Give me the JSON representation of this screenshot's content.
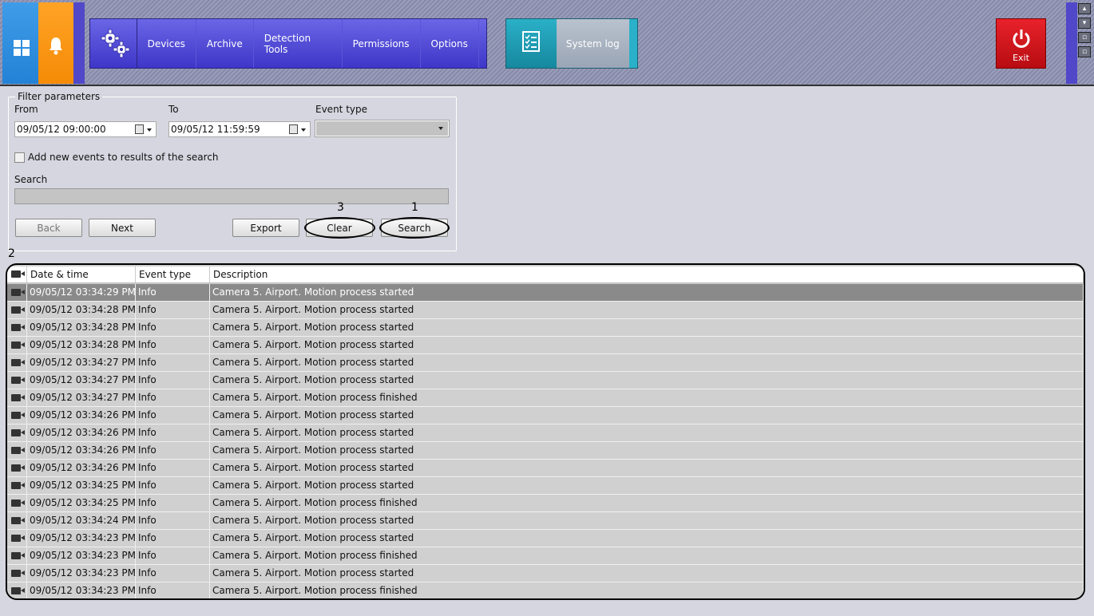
{
  "nav": {
    "items": [
      "Devices",
      "Archive",
      "Detection Tools",
      "Permissions",
      "Options"
    ],
    "active": "System log",
    "exit_label": "Exit"
  },
  "filter": {
    "legend": "Filter parameters",
    "from_label": "From",
    "from_value": "09/05/12 09:00:00",
    "to_label": "To",
    "to_value": "09/05/12 11:59:59",
    "event_type_label": "Event type",
    "event_type_value": "",
    "add_new_label": "Add new events to results of the search",
    "search_label": "Search",
    "search_value": "",
    "buttons": {
      "back": "Back",
      "next": "Next",
      "export": "Export",
      "clear": "Clear",
      "search": "Search"
    }
  },
  "callouts": {
    "search": "1",
    "table": "2",
    "clear": "3"
  },
  "table": {
    "headers": [
      "Date & time",
      "Event type",
      "Description"
    ],
    "rows": [
      {
        "date": "09/05/12 03:34:29 PM",
        "type": "Info",
        "desc": "Camera 5. Airport. Motion process started"
      },
      {
        "date": "09/05/12 03:34:28 PM",
        "type": "Info",
        "desc": "Camera 5. Airport. Motion process started"
      },
      {
        "date": "09/05/12 03:34:28 PM",
        "type": "Info",
        "desc": "Camera 5. Airport. Motion process started"
      },
      {
        "date": "09/05/12 03:34:28 PM",
        "type": "Info",
        "desc": "Camera 5. Airport. Motion process started"
      },
      {
        "date": "09/05/12 03:34:27 PM",
        "type": "Info",
        "desc": "Camera 5. Airport. Motion process started"
      },
      {
        "date": "09/05/12 03:34:27 PM",
        "type": "Info",
        "desc": "Camera 5. Airport. Motion process started"
      },
      {
        "date": "09/05/12 03:34:27 PM",
        "type": "Info",
        "desc": "Camera 5. Airport. Motion process finished"
      },
      {
        "date": "09/05/12 03:34:26 PM",
        "type": "Info",
        "desc": "Camera 5. Airport. Motion process started"
      },
      {
        "date": "09/05/12 03:34:26 PM",
        "type": "Info",
        "desc": "Camera 5. Airport. Motion process started"
      },
      {
        "date": "09/05/12 03:34:26 PM",
        "type": "Info",
        "desc": "Camera 5. Airport. Motion process started"
      },
      {
        "date": "09/05/12 03:34:26 PM",
        "type": "Info",
        "desc": "Camera 5. Airport. Motion process started"
      },
      {
        "date": "09/05/12 03:34:25 PM",
        "type": "Info",
        "desc": "Camera 5. Airport. Motion process started"
      },
      {
        "date": "09/05/12 03:34:25 PM",
        "type": "Info",
        "desc": "Camera 5. Airport. Motion process finished"
      },
      {
        "date": "09/05/12 03:34:24 PM",
        "type": "Info",
        "desc": "Camera 5. Airport. Motion process started"
      },
      {
        "date": "09/05/12 03:34:23 PM",
        "type": "Info",
        "desc": "Camera 5. Airport. Motion process started"
      },
      {
        "date": "09/05/12 03:34:23 PM",
        "type": "Info",
        "desc": "Camera 5. Airport. Motion process finished"
      },
      {
        "date": "09/05/12 03:34:23 PM",
        "type": "Info",
        "desc": "Camera 5. Airport. Motion process started"
      },
      {
        "date": "09/05/12 03:34:23 PM",
        "type": "Info",
        "desc": "Camera 5. Airport. Motion process finished"
      }
    ]
  },
  "icons": {
    "windows": "windows-icon",
    "bell": "bell-icon",
    "gear": "gear-icon",
    "syslog": "checklist-icon",
    "exit": "power-icon",
    "camera": "camera-icon",
    "calendar": "calendar-icon"
  },
  "colors": {
    "nav_blue": "#4a44d4",
    "syslog_teal": "#1fa0b8",
    "exit_red": "#d4141c",
    "selected_row": "#8a8a8a"
  }
}
